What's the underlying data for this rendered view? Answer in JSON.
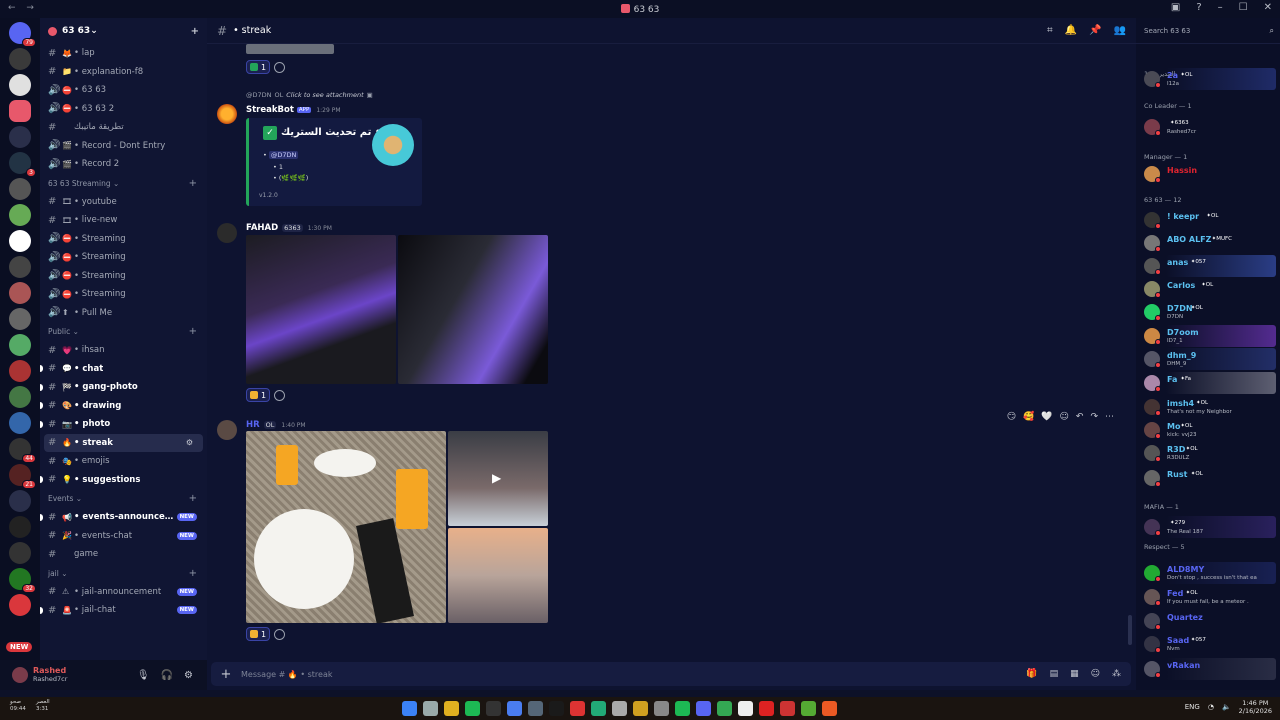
{
  "window": {
    "title": "63 63"
  },
  "server": {
    "name": "63 63"
  },
  "server_badges": [
    "79",
    "",
    "",
    "",
    "",
    "3",
    "",
    "",
    "",
    "",
    "",
    "",
    "",
    "",
    "",
    "",
    "44",
    "21",
    "",
    "",
    "",
    "32",
    "NEW"
  ],
  "channels_top": [
    {
      "emoji": "🦊",
      "label": "lap"
    },
    {
      "emoji": "📁",
      "label": "explanation-f8"
    },
    {
      "emoji": "⛔",
      "label": "63 63"
    },
    {
      "emoji": "⛔",
      "label": "63 63 2"
    },
    {
      "emoji": "",
      "label": "تطريقة ماتيبك"
    },
    {
      "emoji": "🎬",
      "label": "Record - Dont Entry"
    },
    {
      "emoji": "🎬",
      "label": "Record 2"
    }
  ],
  "categories": {
    "streaming": "63 63 Streaming",
    "public": "Public",
    "events": "Events",
    "jail": "jail"
  },
  "channels_streaming": [
    {
      "emoji": "🎞",
      "label": "youtube"
    },
    {
      "emoji": "🎞",
      "label": "live-new"
    },
    {
      "emoji": "⛔",
      "label": "Streaming"
    },
    {
      "emoji": "⛔",
      "label": "Streaming"
    },
    {
      "emoji": "⛔",
      "label": "Streaming"
    },
    {
      "emoji": "⛔",
      "label": "Streaming"
    },
    {
      "emoji": "⬆",
      "label": "Pull Me"
    }
  ],
  "channels_public": [
    {
      "emoji": "💗",
      "label": "ihsan"
    },
    {
      "emoji": "💬",
      "label": "chat"
    },
    {
      "emoji": "🏁",
      "label": "gang-photo"
    },
    {
      "emoji": "🎨",
      "label": "drawing"
    },
    {
      "emoji": "📷",
      "label": "photo"
    },
    {
      "emoji": "🔥",
      "label": "streak"
    },
    {
      "emoji": "🎭",
      "label": "emojis"
    },
    {
      "emoji": "💡",
      "label": "suggestions"
    }
  ],
  "channels_events": [
    {
      "emoji": "📢",
      "label": "events-announcem...",
      "new": "NEW"
    },
    {
      "emoji": "🎉",
      "label": "events-chat",
      "new": "NEW"
    },
    {
      "emoji": "",
      "label": "game"
    }
  ],
  "channels_jail": [
    {
      "emoji": "⚠",
      "label": "jail-announcement",
      "new": "NEW"
    },
    {
      "emoji": "🚨",
      "label": "jail-chat",
      "new": "NEW"
    }
  ],
  "new_pill": "NEW",
  "user": {
    "name": "Rashed",
    "status": "Rashed7cr"
  },
  "header": {
    "channel": "• streak"
  },
  "messages": {
    "streak_reply": {
      "user": "@D7DN",
      "tag": "OL",
      "text": "Click to see attachment"
    },
    "streakbot": {
      "name": "StreakBot",
      "badge": "APP",
      "time": "1:29 PM",
      "embed_title": "تم تحديث الستريك •",
      "mention": "@D7DN",
      "line1": "• 1",
      "line2": "• (🌿🌿🌿)",
      "version": "v1.2.0"
    },
    "fahad": {
      "name": "FAHAD",
      "tag": "6363",
      "time": "1:30 PM"
    },
    "hr": {
      "name": "HR",
      "tag": "OL",
      "time": "1:40 PM"
    },
    "react_count": "1"
  },
  "composer": {
    "placeholder": "Message # 🔥 • streak"
  },
  "members": {
    "search_placeholder": "Search 63 63",
    "groups": [
      "المدير — 1",
      "Co Leader — 1",
      "Manager — 1",
      "63 63 — 12",
      "MAFIA — 1",
      "Respect — 5"
    ],
    "list": [
      {
        "name": "2a",
        "tag": "OL",
        "sub": "I12a",
        "color": "#5865f2",
        "band": "#2a3a8a"
      },
      {
        "name": "",
        "tag": "6363",
        "sub": "Rashed7cr",
        "color": "#e05a5a",
        "band": ""
      },
      {
        "name": "Hassin",
        "tag": "",
        "sub": "",
        "color": "#e0242f",
        "band": ""
      },
      {
        "name": "! keepr",
        "tag": "OL",
        "sub": "",
        "color": "#5bc0f0",
        "band": ""
      },
      {
        "name": "ABO ALFZ",
        "tag": "MUFC",
        "sub": "",
        "color": "#5bc0f0",
        "band": ""
      },
      {
        "name": "anas",
        "tag": "057",
        "sub": "",
        "color": "#5bc0f0",
        "band": "#3b56b8"
      },
      {
        "name": "Carlos",
        "tag": "OL",
        "sub": "",
        "color": "#5bc0f0",
        "band": ""
      },
      {
        "name": "D7DN",
        "tag": "OL",
        "sub": "D7DN",
        "color": "#5bc0f0",
        "band": ""
      },
      {
        "name": "D7oom",
        "tag": "",
        "sub": "ID7_1",
        "color": "#5bc0f0",
        "band": "#7a3ac8"
      },
      {
        "name": "dhm_9",
        "tag": "",
        "sub": "DHM_9",
        "color": "#5bc0f0",
        "band": "#2f3f8a"
      },
      {
        "name": "Fa",
        "tag": "Fa",
        "sub": "",
        "color": "#5bc0f0",
        "band": "#8a8a9a"
      },
      {
        "name": "imsh4",
        "tag": "OL",
        "sub": "That's not my Neighbor",
        "color": "#5bc0f0",
        "band": ""
      },
      {
        "name": "Mo",
        "tag": "OL",
        "sub": "kick: vvj23",
        "color": "#5bc0f0",
        "band": ""
      },
      {
        "name": "R3D",
        "tag": "OL",
        "sub": "R3DULZ",
        "color": "#5bc0f0",
        "band": ""
      },
      {
        "name": "Rust",
        "tag": "OL",
        "sub": "",
        "color": "#5bc0f0",
        "band": ""
      },
      {
        "name": "",
        "tag": "279",
        "sub": "The Real 187",
        "color": "#fff",
        "band": "#3a2a7a"
      },
      {
        "name": "ALD8MY",
        "tag": "",
        "sub": "Don't stop , success isn't that ea",
        "color": "#5865f2",
        "band": "#1f2a6a"
      },
      {
        "name": "Fed",
        "tag": "OL",
        "sub": "If you must fall, be a meteor .",
        "color": "#5865f2",
        "band": ""
      },
      {
        "name": "Quartez",
        "tag": "",
        "sub": "",
        "color": "#5865f2",
        "band": ""
      },
      {
        "name": "Saad",
        "tag": "057",
        "sub": "Nvm",
        "color": "#5865f2",
        "band": ""
      },
      {
        "name": "vRakan",
        "tag": "",
        "sub": "",
        "color": "#5865f2",
        "band": "#3a3d55"
      }
    ]
  },
  "taskbar": {
    "left1": "صحو",
    "left2": "09:44",
    "left3": "العصر",
    "left4": "3:31",
    "time": "1:46 PM",
    "date": "2/16/2026",
    "lang": "ENG"
  }
}
